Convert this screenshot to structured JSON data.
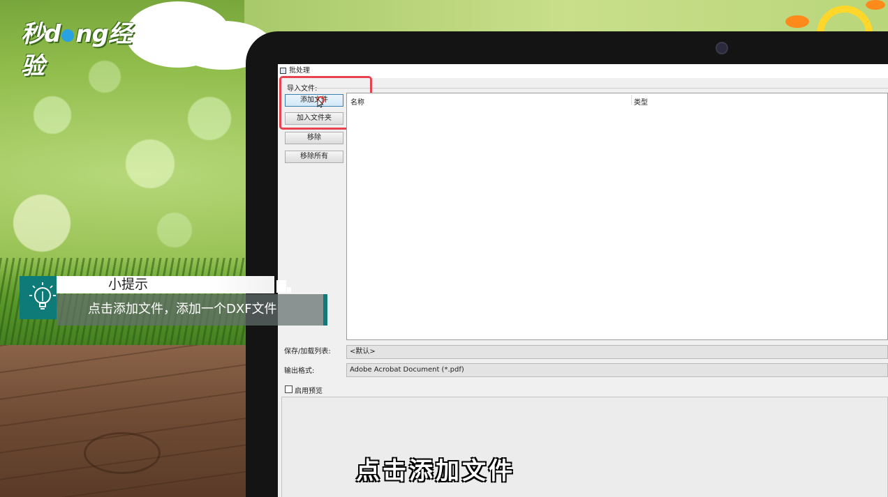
{
  "logo": {
    "text_before": "秒d",
    "text_after": "ng经验"
  },
  "window": {
    "title": "批处理",
    "import_group_label": "导入文件:",
    "buttons": {
      "add_file": "添加文件",
      "add_folder": "加入文件夹",
      "remove": "移除",
      "remove_all": "移除所有"
    },
    "list_columns": [
      "名称",
      "类型"
    ],
    "save_load_list_label": "保存/加载列表:",
    "save_load_list_value": "<默认>",
    "output_format_label": "输出格式:",
    "output_format_value": "Adobe Acrobat Document (*.pdf)",
    "enable_preview_label": "启用预览",
    "enable_preview_checked": false
  },
  "tip": {
    "title": "小提示",
    "text": "点击添加文件，添加一个DXF文件"
  },
  "subtitle": "点击添加文件",
  "colors": {
    "highlight": "#e8424f",
    "tip_accent": "#0f7b78"
  },
  "icons": [
    "lightbulb-icon",
    "window-icon",
    "cursor-icon"
  ]
}
